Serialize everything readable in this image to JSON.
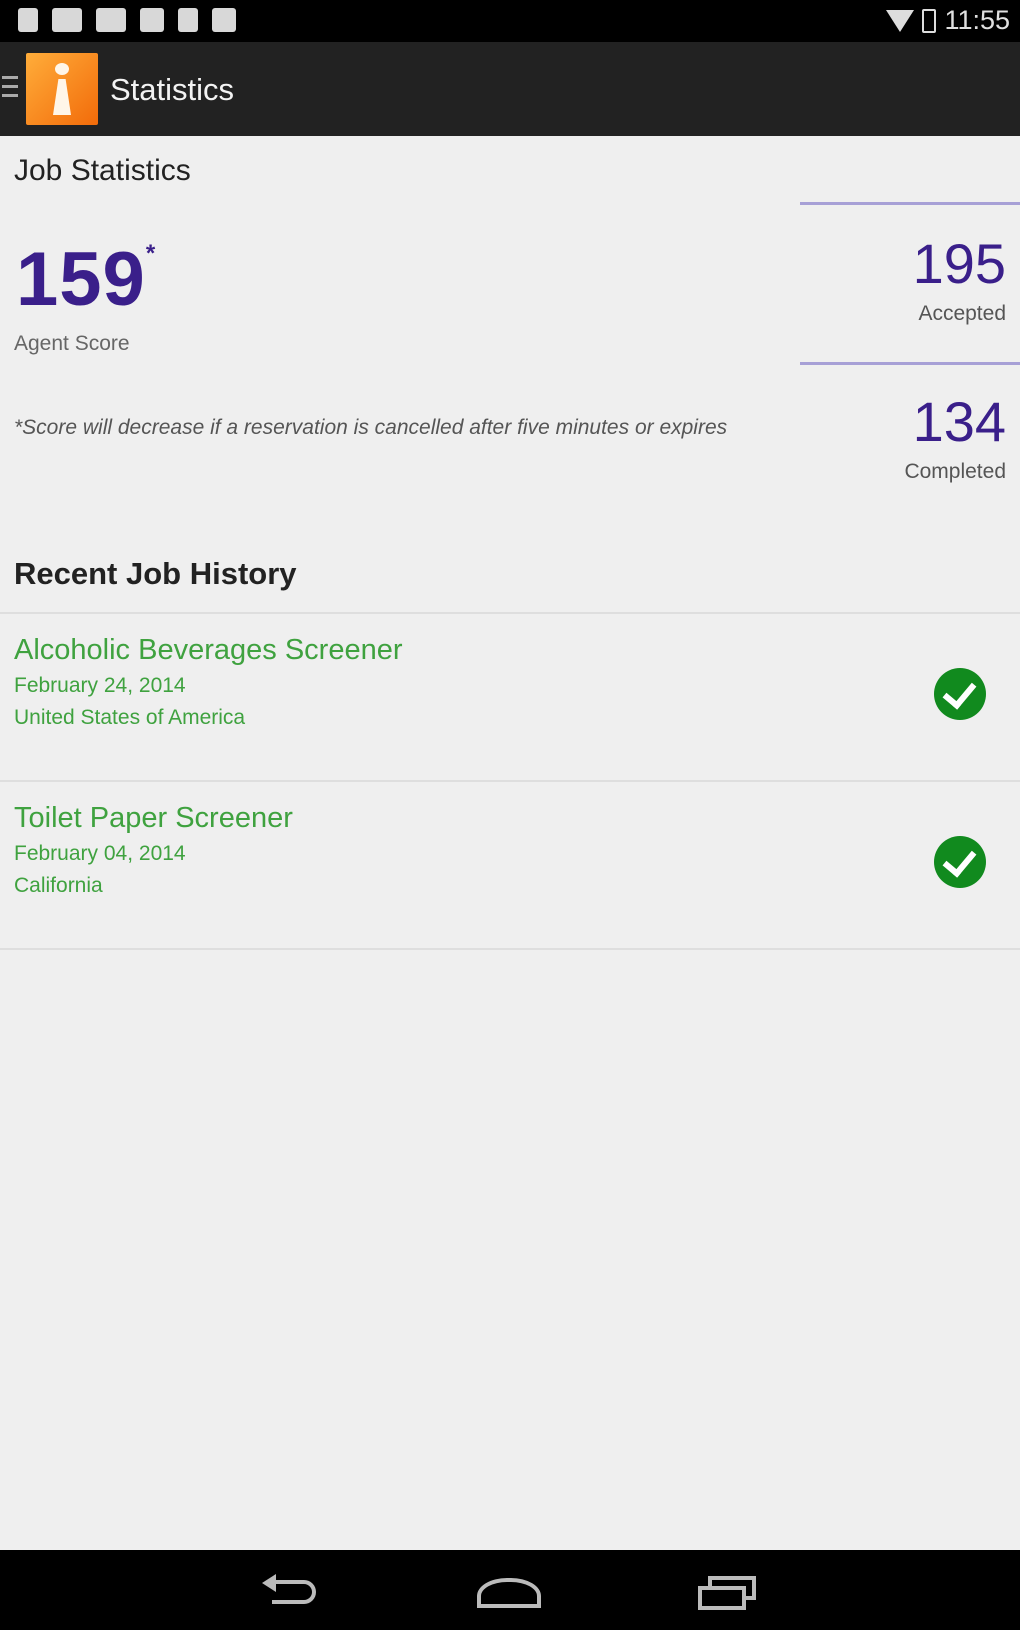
{
  "status_bar": {
    "time": "11:55"
  },
  "action_bar": {
    "title": "Statistics"
  },
  "stats": {
    "section_title": "Job Statistics",
    "agent_score": "159",
    "agent_score_marker": "*",
    "agent_score_label": "Agent Score",
    "footnote": "*Score will decrease if a reservation is cancelled after five minutes or expires",
    "accepted_value": "195",
    "accepted_label": "Accepted",
    "completed_value": "134",
    "completed_label": "Completed"
  },
  "history": {
    "title": "Recent Job History",
    "items": [
      {
        "job": "Alcoholic Beverages Screener",
        "date": "February 24, 2014",
        "location": "United States of America",
        "status_icon": "check-circle-icon"
      },
      {
        "job": "Toilet Paper Screener",
        "date": "February 04, 2014",
        "location": "California",
        "status_icon": "check-circle-icon"
      }
    ]
  },
  "colors": {
    "accent": "#3a1f8a",
    "success": "#3fa23f",
    "logo": "#f26b0a"
  }
}
